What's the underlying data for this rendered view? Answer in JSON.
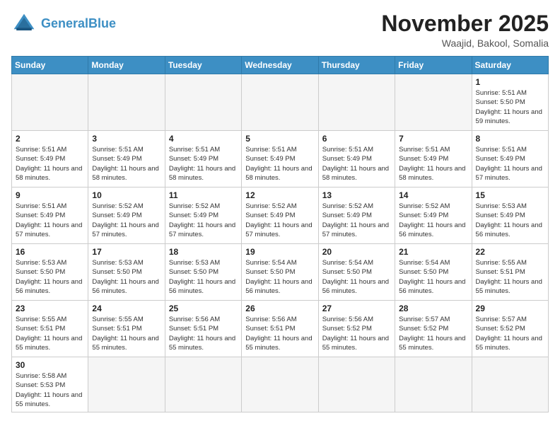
{
  "header": {
    "logo_general": "General",
    "logo_blue": "Blue",
    "month_title": "November 2025",
    "location": "Waajid, Bakool, Somalia"
  },
  "weekdays": [
    "Sunday",
    "Monday",
    "Tuesday",
    "Wednesday",
    "Thursday",
    "Friday",
    "Saturday"
  ],
  "days": [
    {
      "num": "",
      "sunrise": "",
      "sunset": "",
      "daylight": "",
      "empty": true
    },
    {
      "num": "",
      "sunrise": "",
      "sunset": "",
      "daylight": "",
      "empty": true
    },
    {
      "num": "",
      "sunrise": "",
      "sunset": "",
      "daylight": "",
      "empty": true
    },
    {
      "num": "",
      "sunrise": "",
      "sunset": "",
      "daylight": "",
      "empty": true
    },
    {
      "num": "",
      "sunrise": "",
      "sunset": "",
      "daylight": "",
      "empty": true
    },
    {
      "num": "",
      "sunrise": "",
      "sunset": "",
      "daylight": "",
      "empty": true
    },
    {
      "num": "1",
      "sunrise": "Sunrise: 5:51 AM",
      "sunset": "Sunset: 5:50 PM",
      "daylight": "Daylight: 11 hours and 59 minutes.",
      "empty": false
    },
    {
      "num": "2",
      "sunrise": "Sunrise: 5:51 AM",
      "sunset": "Sunset: 5:49 PM",
      "daylight": "Daylight: 11 hours and 58 minutes.",
      "empty": false
    },
    {
      "num": "3",
      "sunrise": "Sunrise: 5:51 AM",
      "sunset": "Sunset: 5:49 PM",
      "daylight": "Daylight: 11 hours and 58 minutes.",
      "empty": false
    },
    {
      "num": "4",
      "sunrise": "Sunrise: 5:51 AM",
      "sunset": "Sunset: 5:49 PM",
      "daylight": "Daylight: 11 hours and 58 minutes.",
      "empty": false
    },
    {
      "num": "5",
      "sunrise": "Sunrise: 5:51 AM",
      "sunset": "Sunset: 5:49 PM",
      "daylight": "Daylight: 11 hours and 58 minutes.",
      "empty": false
    },
    {
      "num": "6",
      "sunrise": "Sunrise: 5:51 AM",
      "sunset": "Sunset: 5:49 PM",
      "daylight": "Daylight: 11 hours and 58 minutes.",
      "empty": false
    },
    {
      "num": "7",
      "sunrise": "Sunrise: 5:51 AM",
      "sunset": "Sunset: 5:49 PM",
      "daylight": "Daylight: 11 hours and 58 minutes.",
      "empty": false
    },
    {
      "num": "8",
      "sunrise": "Sunrise: 5:51 AM",
      "sunset": "Sunset: 5:49 PM",
      "daylight": "Daylight: 11 hours and 57 minutes.",
      "empty": false
    },
    {
      "num": "9",
      "sunrise": "Sunrise: 5:51 AM",
      "sunset": "Sunset: 5:49 PM",
      "daylight": "Daylight: 11 hours and 57 minutes.",
      "empty": false
    },
    {
      "num": "10",
      "sunrise": "Sunrise: 5:52 AM",
      "sunset": "Sunset: 5:49 PM",
      "daylight": "Daylight: 11 hours and 57 minutes.",
      "empty": false
    },
    {
      "num": "11",
      "sunrise": "Sunrise: 5:52 AM",
      "sunset": "Sunset: 5:49 PM",
      "daylight": "Daylight: 11 hours and 57 minutes.",
      "empty": false
    },
    {
      "num": "12",
      "sunrise": "Sunrise: 5:52 AM",
      "sunset": "Sunset: 5:49 PM",
      "daylight": "Daylight: 11 hours and 57 minutes.",
      "empty": false
    },
    {
      "num": "13",
      "sunrise": "Sunrise: 5:52 AM",
      "sunset": "Sunset: 5:49 PM",
      "daylight": "Daylight: 11 hours and 57 minutes.",
      "empty": false
    },
    {
      "num": "14",
      "sunrise": "Sunrise: 5:52 AM",
      "sunset": "Sunset: 5:49 PM",
      "daylight": "Daylight: 11 hours and 56 minutes.",
      "empty": false
    },
    {
      "num": "15",
      "sunrise": "Sunrise: 5:53 AM",
      "sunset": "Sunset: 5:49 PM",
      "daylight": "Daylight: 11 hours and 56 minutes.",
      "empty": false
    },
    {
      "num": "16",
      "sunrise": "Sunrise: 5:53 AM",
      "sunset": "Sunset: 5:50 PM",
      "daylight": "Daylight: 11 hours and 56 minutes.",
      "empty": false
    },
    {
      "num": "17",
      "sunrise": "Sunrise: 5:53 AM",
      "sunset": "Sunset: 5:50 PM",
      "daylight": "Daylight: 11 hours and 56 minutes.",
      "empty": false
    },
    {
      "num": "18",
      "sunrise": "Sunrise: 5:53 AM",
      "sunset": "Sunset: 5:50 PM",
      "daylight": "Daylight: 11 hours and 56 minutes.",
      "empty": false
    },
    {
      "num": "19",
      "sunrise": "Sunrise: 5:54 AM",
      "sunset": "Sunset: 5:50 PM",
      "daylight": "Daylight: 11 hours and 56 minutes.",
      "empty": false
    },
    {
      "num": "20",
      "sunrise": "Sunrise: 5:54 AM",
      "sunset": "Sunset: 5:50 PM",
      "daylight": "Daylight: 11 hours and 56 minutes.",
      "empty": false
    },
    {
      "num": "21",
      "sunrise": "Sunrise: 5:54 AM",
      "sunset": "Sunset: 5:50 PM",
      "daylight": "Daylight: 11 hours and 56 minutes.",
      "empty": false
    },
    {
      "num": "22",
      "sunrise": "Sunrise: 5:55 AM",
      "sunset": "Sunset: 5:51 PM",
      "daylight": "Daylight: 11 hours and 55 minutes.",
      "empty": false
    },
    {
      "num": "23",
      "sunrise": "Sunrise: 5:55 AM",
      "sunset": "Sunset: 5:51 PM",
      "daylight": "Daylight: 11 hours and 55 minutes.",
      "empty": false
    },
    {
      "num": "24",
      "sunrise": "Sunrise: 5:55 AM",
      "sunset": "Sunset: 5:51 PM",
      "daylight": "Daylight: 11 hours and 55 minutes.",
      "empty": false
    },
    {
      "num": "25",
      "sunrise": "Sunrise: 5:56 AM",
      "sunset": "Sunset: 5:51 PM",
      "daylight": "Daylight: 11 hours and 55 minutes.",
      "empty": false
    },
    {
      "num": "26",
      "sunrise": "Sunrise: 5:56 AM",
      "sunset": "Sunset: 5:51 PM",
      "daylight": "Daylight: 11 hours and 55 minutes.",
      "empty": false
    },
    {
      "num": "27",
      "sunrise": "Sunrise: 5:56 AM",
      "sunset": "Sunset: 5:52 PM",
      "daylight": "Daylight: 11 hours and 55 minutes.",
      "empty": false
    },
    {
      "num": "28",
      "sunrise": "Sunrise: 5:57 AM",
      "sunset": "Sunset: 5:52 PM",
      "daylight": "Daylight: 11 hours and 55 minutes.",
      "empty": false
    },
    {
      "num": "29",
      "sunrise": "Sunrise: 5:57 AM",
      "sunset": "Sunset: 5:52 PM",
      "daylight": "Daylight: 11 hours and 55 minutes.",
      "empty": false
    },
    {
      "num": "30",
      "sunrise": "Sunrise: 5:58 AM",
      "sunset": "Sunset: 5:53 PM",
      "daylight": "Daylight: 11 hours and 55 minutes.",
      "empty": false
    },
    {
      "num": "",
      "sunrise": "",
      "sunset": "",
      "daylight": "",
      "empty": true
    },
    {
      "num": "",
      "sunrise": "",
      "sunset": "",
      "daylight": "",
      "empty": true
    },
    {
      "num": "",
      "sunrise": "",
      "sunset": "",
      "daylight": "",
      "empty": true
    },
    {
      "num": "",
      "sunrise": "",
      "sunset": "",
      "daylight": "",
      "empty": true
    },
    {
      "num": "",
      "sunrise": "",
      "sunset": "",
      "daylight": "",
      "empty": true
    },
    {
      "num": "",
      "sunrise": "",
      "sunset": "",
      "daylight": "",
      "empty": true
    }
  ]
}
